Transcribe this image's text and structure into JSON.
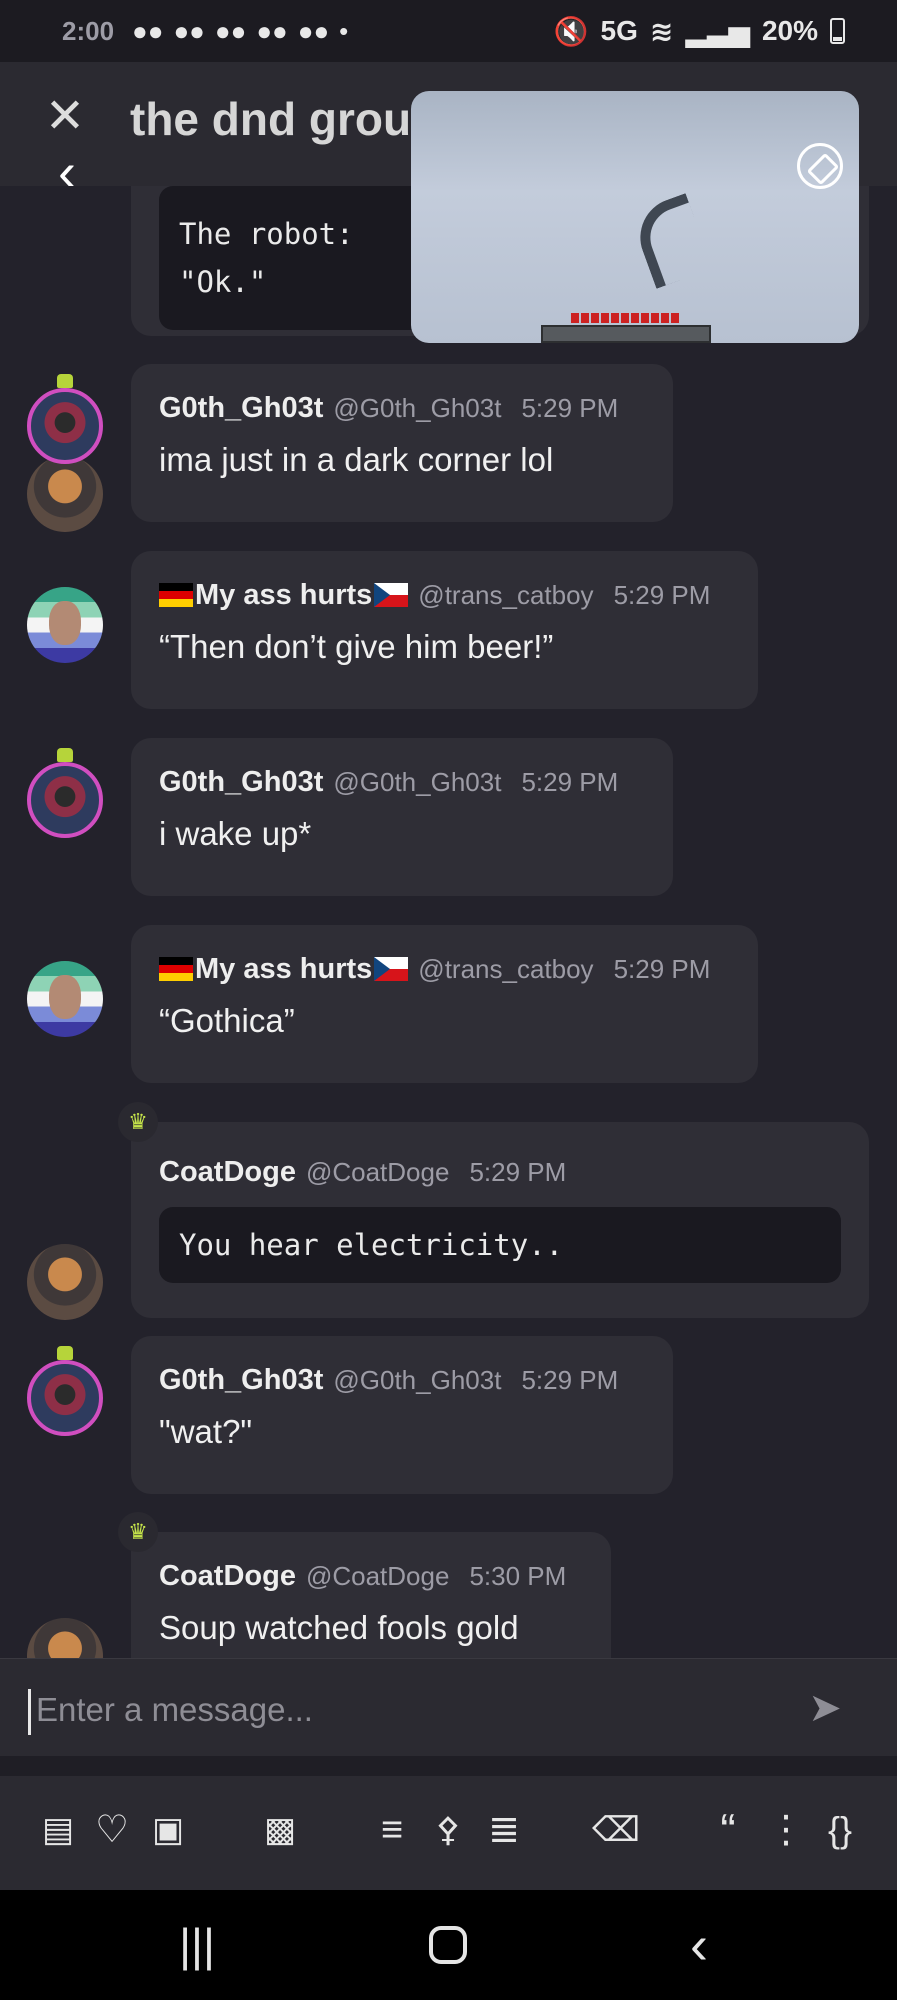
{
  "status_bar": {
    "time": "2:00",
    "notif_icons": [
      "discord-icon",
      "discord-icon",
      "discord-icon",
      "discord-icon",
      "discord-icon",
      "dot"
    ],
    "right": {
      "network": "5G",
      "battery": "20%"
    }
  },
  "header": {
    "title": "the dnd group"
  },
  "messages": [
    {
      "author": "",
      "handle": "",
      "time": "",
      "code": "The robot:\n\"Ok.\"",
      "avatar": "doge"
    },
    {
      "author": "G0th_Gh03t",
      "handle": "@G0th_Gh03t",
      "time": "5:29 PM",
      "text": "ima just in a dark corner lol",
      "avatar": "goth"
    },
    {
      "author": "My ass hurts",
      "handle": "@trans_catboy",
      "time": "5:29 PM",
      "text": "“Then don’t give him beer!”",
      "avatar": "cat"
    },
    {
      "author": "G0th_Gh03t",
      "handle": "@G0th_Gh03t",
      "time": "5:29 PM",
      "text": "i wake up*",
      "avatar": "goth"
    },
    {
      "author": "My ass hurts",
      "handle": "@trans_catboy",
      "time": "5:29 PM",
      "text": "“Gothica”",
      "avatar": "cat"
    },
    {
      "author": "CoatDoge",
      "handle": "@CoatDoge",
      "time": "5:29 PM",
      "code": "You hear electricity..",
      "avatar": "doge"
    },
    {
      "author": "G0th_Gh03t",
      "handle": "@G0th_Gh03t",
      "time": "5:29 PM",
      "text": "\"wat?\"",
      "avatar": "goth"
    },
    {
      "author": "CoatDoge",
      "handle": "@CoatDoge",
      "time": "5:30 PM",
      "text": "Soup watched fools gold",
      "avatar": "doge"
    }
  ],
  "composer": {
    "placeholder": "Enter a message..."
  },
  "toolbar": {
    "buttons": [
      "sticker-icon",
      "heart-icon",
      "image-icon",
      "nsfw-image-icon",
      "bullet-list-icon",
      "share-icon",
      "numbered-list-icon",
      "trash-icon",
      "quote-icon",
      "more-icon",
      "code-braces-icon"
    ]
  },
  "colors": {
    "background": "#23222b",
    "bubble": "#2f2e36",
    "accent_crown": "#c7e64b"
  }
}
